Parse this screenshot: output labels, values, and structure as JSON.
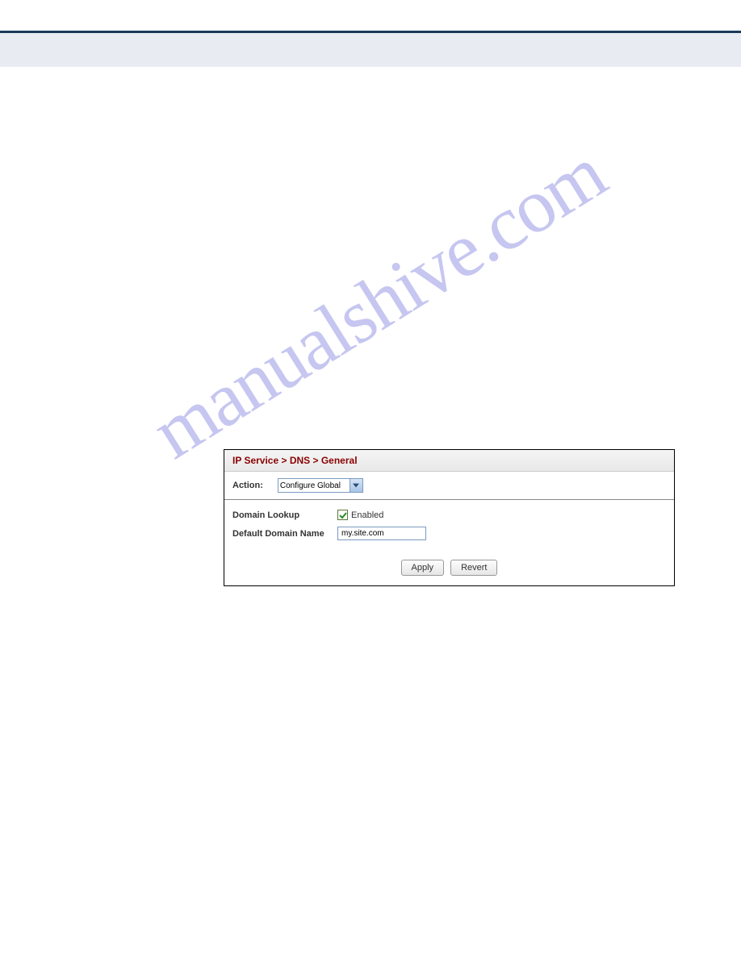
{
  "watermark": "manualshive.com",
  "panel": {
    "breadcrumb": "IP Service > DNS > General",
    "action": {
      "label": "Action:",
      "selected": "Configure Global"
    },
    "form": {
      "domain_lookup": {
        "label": "Domain Lookup",
        "enabled_text": "Enabled"
      },
      "default_domain": {
        "label": "Default Domain Name",
        "value": "my.site.com"
      }
    },
    "buttons": {
      "apply": "Apply",
      "revert": "Revert"
    }
  }
}
